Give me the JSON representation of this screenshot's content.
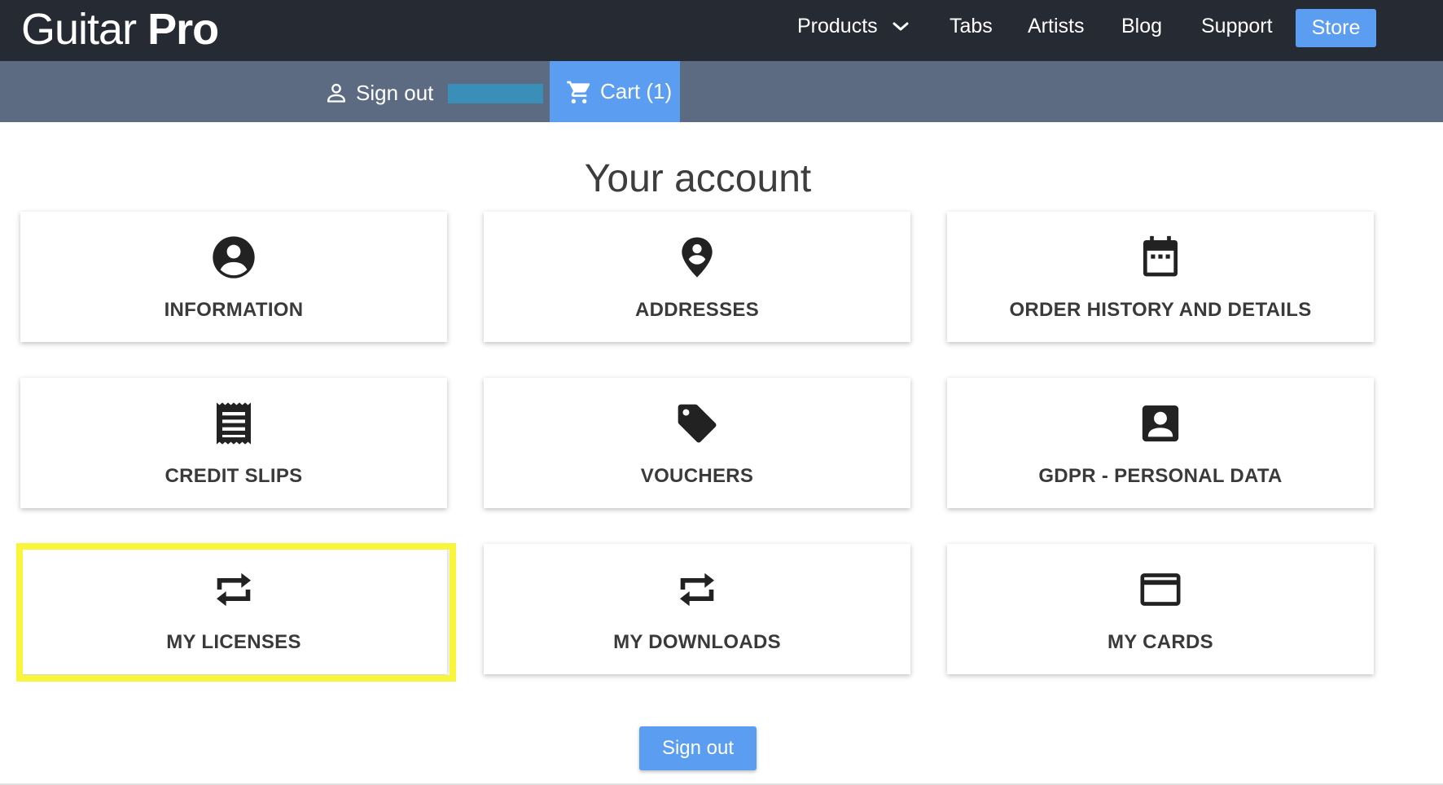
{
  "header": {
    "logo_part1": "Guitar",
    "logo_part2": "Pro",
    "nav": {
      "products": "Products",
      "tabs": "Tabs",
      "artists": "Artists",
      "blog": "Blog",
      "support": "Support",
      "store": "Store"
    }
  },
  "subbar": {
    "sign_out": "Sign out",
    "cart": "Cart (1)"
  },
  "main": {
    "title": "Your account",
    "cards": [
      {
        "label": "INFORMATION",
        "icon": "user-circle-icon"
      },
      {
        "label": "ADDRESSES",
        "icon": "location-pin-icon"
      },
      {
        "label": "ORDER HISTORY AND DETAILS",
        "icon": "calendar-icon"
      },
      {
        "label": "CREDIT SLIPS",
        "icon": "receipt-icon"
      },
      {
        "label": "VOUCHERS",
        "icon": "tag-icon"
      },
      {
        "label": "GDPR - PERSONAL DATA",
        "icon": "account-box-icon"
      },
      {
        "label": "MY LICENSES",
        "icon": "repeat-icon"
      },
      {
        "label": "MY DOWNLOADS",
        "icon": "repeat-icon"
      },
      {
        "label": "MY CARDS",
        "icon": "credit-card-icon"
      }
    ],
    "sign_out_button": "Sign out"
  },
  "colors": {
    "topbar": "#262a33",
    "subbar": "#5c6b82",
    "accent": "#5b9df0",
    "highlight": "#f8f53a"
  }
}
